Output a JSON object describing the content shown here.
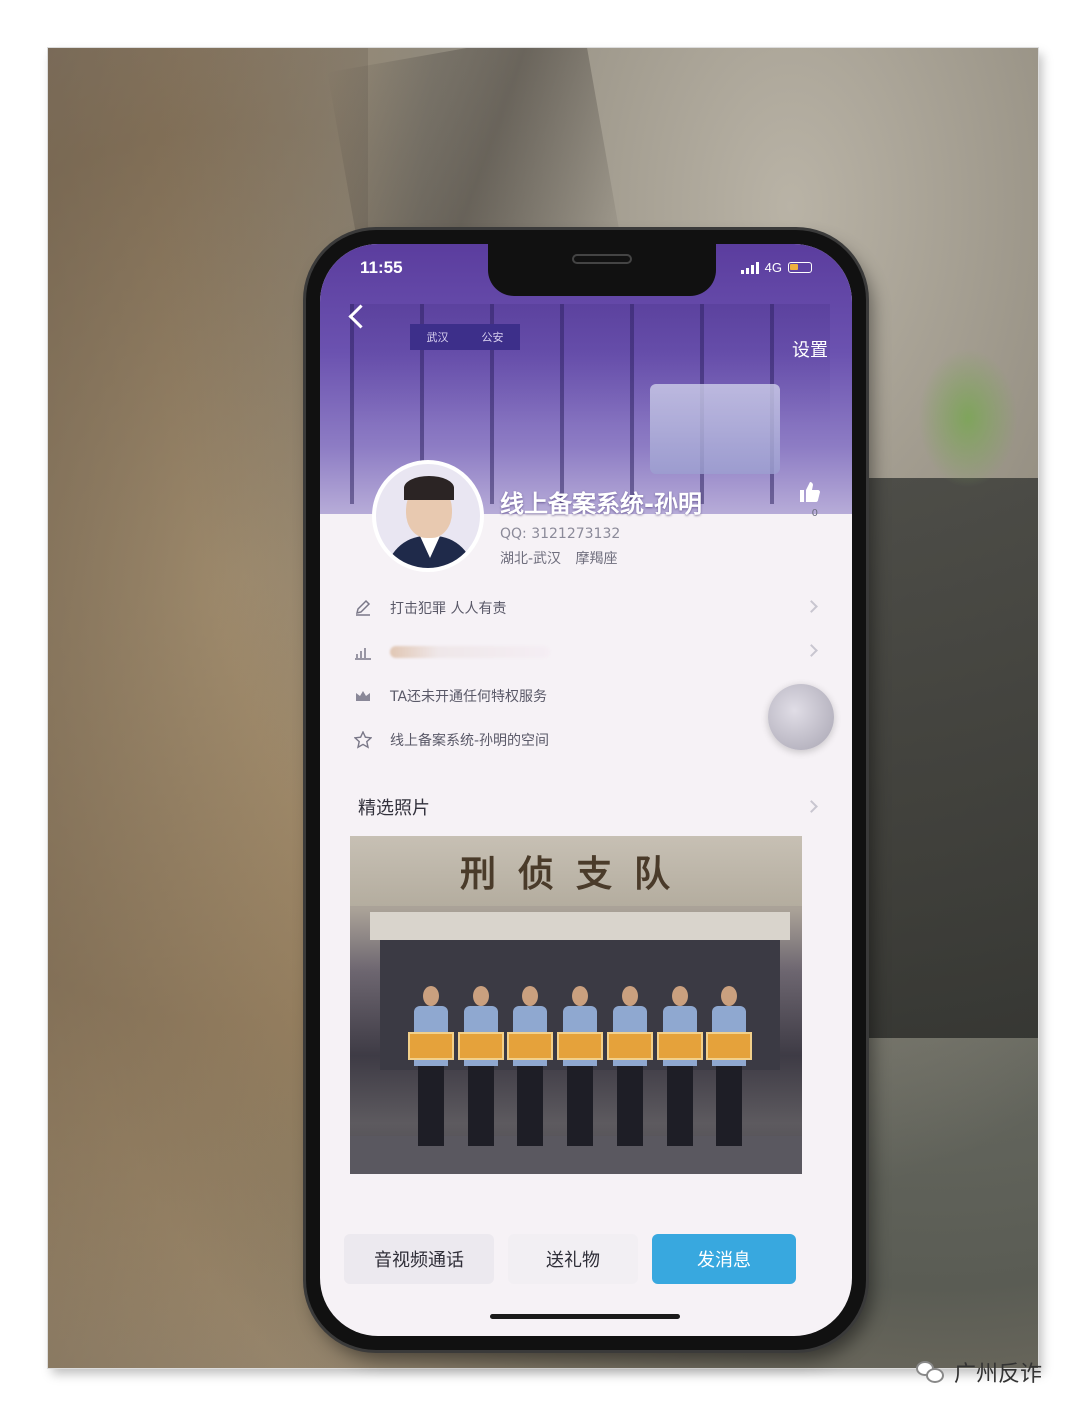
{
  "status_bar": {
    "time": "11:55",
    "network": "4G"
  },
  "header": {
    "back_icon": "chevron-left-icon",
    "settings_label": "设置",
    "banner_sign_left": "武汉",
    "banner_sign_right": "公安"
  },
  "profile": {
    "name": "线上备案系统-孙明",
    "qq": "QQ:  3121273132",
    "region": "湖北-武汉",
    "zodiac": "摩羯座",
    "likes": "0"
  },
  "info_items": [
    {
      "icon": "pencil-icon",
      "text": "打击犯罪 人人有责"
    },
    {
      "icon": "level-icon",
      "text": ""
    },
    {
      "icon": "crown-icon",
      "text": "TA还未开通任何特权服务"
    },
    {
      "icon": "star-icon",
      "text": "线上备案系统-孙明的空间"
    }
  ],
  "featured": {
    "title": "精选照片",
    "photo_sign": "刑侦支队"
  },
  "actions": {
    "call": "音视频通话",
    "gift": "送礼物",
    "message": "发消息"
  },
  "watermark": {
    "text": "广州反诈"
  },
  "colors": {
    "header": "#5b3d9e",
    "message_button": "#38a8df"
  }
}
